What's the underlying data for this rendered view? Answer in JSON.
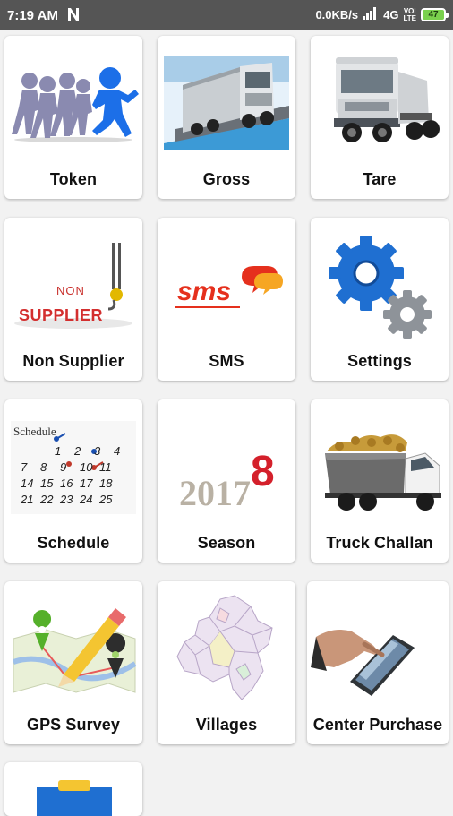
{
  "status_bar": {
    "time": "7:19 AM",
    "network_speed": "0.0KB/s",
    "network_type": "4G",
    "volte_top": "VOl",
    "volte_bottom": "LTE",
    "battery": "47"
  },
  "menu": {
    "items": [
      {
        "label": "Token",
        "icon": "people-running-icon"
      },
      {
        "label": "Gross",
        "icon": "loaded-truck-on-weighbridge-icon"
      },
      {
        "label": "Tare",
        "icon": "truck-cab-icon"
      },
      {
        "label": "Non Supplier",
        "icon": "non-supplier-crane-icon"
      },
      {
        "label": "SMS",
        "icon": "sms-logo-icon"
      },
      {
        "label": "Settings",
        "icon": "gears-icon"
      },
      {
        "label": "Schedule",
        "icon": "calendar-schedule-icon"
      },
      {
        "label": "Season",
        "icon": "year-2017-2018-icon"
      },
      {
        "label": "Truck Challan",
        "icon": "sugarcane-truck-icon"
      },
      {
        "label": "GPS Survey",
        "icon": "map-pencil-pins-icon"
      },
      {
        "label": "Villages",
        "icon": "district-map-icon"
      },
      {
        "label": "Center Purchase",
        "icon": "tablet-hand-icon"
      },
      {
        "label": "",
        "icon": "clipboard-icon"
      }
    ],
    "sms_logo_text": "sms",
    "non_supplier_top": "NON",
    "non_supplier_bottom": "SUPPLIER",
    "schedule_header": "Schedule",
    "season_year": "2017",
    "season_new_digit": "8",
    "calendar_numbers": [
      "1",
      "2",
      "3",
      "4",
      "7",
      "8",
      "9",
      "10",
      "11",
      "14",
      "15",
      "16",
      "17",
      "18",
      "21",
      "22",
      "23",
      "24",
      "25"
    ]
  },
  "colors": {
    "status_bar": "#555555",
    "background": "#f2f2f2",
    "sms_red": "#e5301d",
    "season_red": "#d4202b",
    "gear_blue": "#1f6fd1",
    "runner_blue": "#1c6fe8"
  }
}
